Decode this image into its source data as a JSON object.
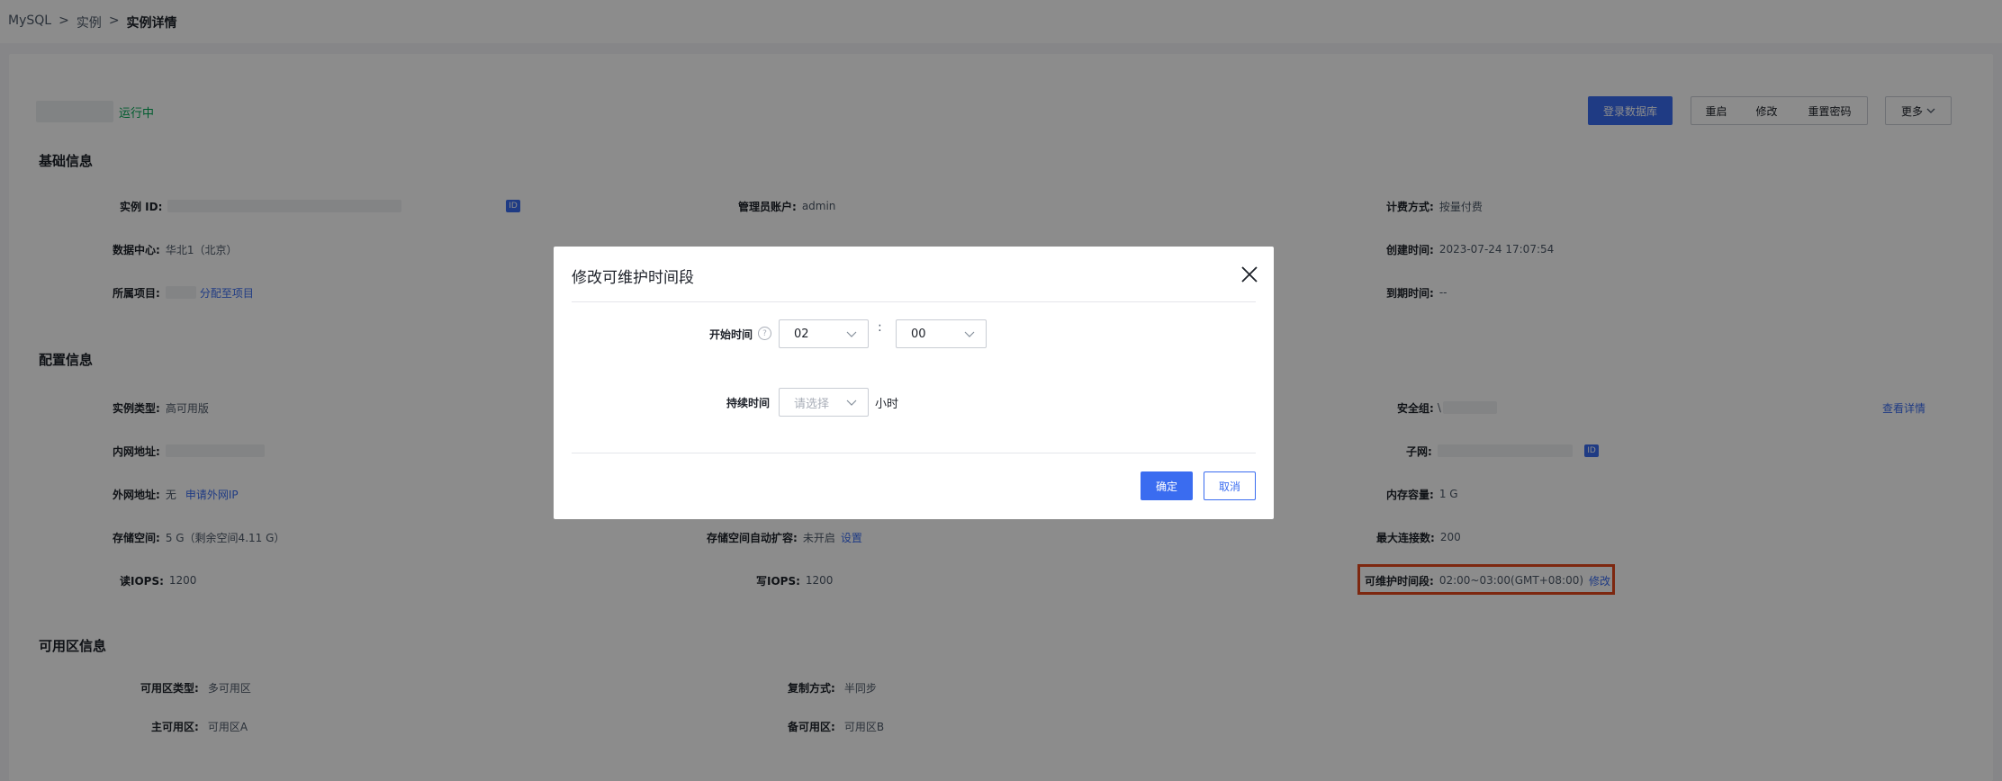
{
  "breadcrumb": {
    "item1": "MySQL",
    "sep": ">",
    "item2": "实例",
    "item3": "实例详情"
  },
  "instance": {
    "status": "运行中"
  },
  "actions": {
    "login_db": "登录数据库",
    "restart": "重启",
    "modify": "修改",
    "reset_password": "重置密码",
    "more": "更多"
  },
  "basic": {
    "title": "基础信息",
    "instance_id_label": "实例 ID:",
    "id_badge": "ID",
    "admin_label": "管理员账户:",
    "admin_value": "admin",
    "billing_label": "计费方式:",
    "billing_value": "按量付费",
    "dc_label": "数据中心:",
    "dc_value": "华北1（北京）",
    "created_label": "创建时间:",
    "created_value": "2023-07-24 17:07:54",
    "project_label": "所属项目:",
    "project_link": "分配至项目",
    "expire_label": "到期时间:",
    "expire_value": "--"
  },
  "config": {
    "title": "配置信息",
    "type_label": "实例类型:",
    "type_value": "高可用版",
    "sg_label": "安全组:",
    "sg_value": "\\",
    "sg_link": "查看详情",
    "intranet_label": "内网地址:",
    "subnet_label": "子网:",
    "subnet_badge": "ID",
    "internet_label": "外网地址:",
    "internet_value": "无",
    "internet_link": "申请外网IP",
    "memory_label": "内存容量:",
    "memory_value": "1 G",
    "storage_label": "存储空间:",
    "storage_value": "5 G（剩余空间4.11 G）",
    "autoscale_label": "存储空间自动扩容:",
    "autoscale_value": "未开启",
    "autoscale_link": "设置",
    "maxconn_label": "最大连接数:",
    "maxconn_value": "200",
    "read_iops_label": "读IOPS:",
    "read_iops_value": "1200",
    "write_iops_label": "写IOPS:",
    "write_iops_value": "1200",
    "maint_label": "可维护时间段:",
    "maint_value": "02:00~03:00(GMT+08:00)",
    "maint_link": "修改"
  },
  "zone": {
    "title": "可用区信息",
    "zone_type_label": "可用区类型:",
    "zone_type_value": "多可用区",
    "replication_label": "复制方式:",
    "replication_value": "半同步",
    "primary_label": "主可用区:",
    "primary_value": "可用区A",
    "standby_label": "备可用区:",
    "standby_value": "可用区B"
  },
  "modal": {
    "title": "修改可维护时间段",
    "start_label": "开始时间",
    "help": "?",
    "start_hour": "02",
    "colon": ":",
    "start_minute": "00",
    "duration_label": "持续时间",
    "duration_placeholder": "请选择",
    "duration_unit": "小时",
    "confirm": "确定",
    "cancel": "取消"
  }
}
